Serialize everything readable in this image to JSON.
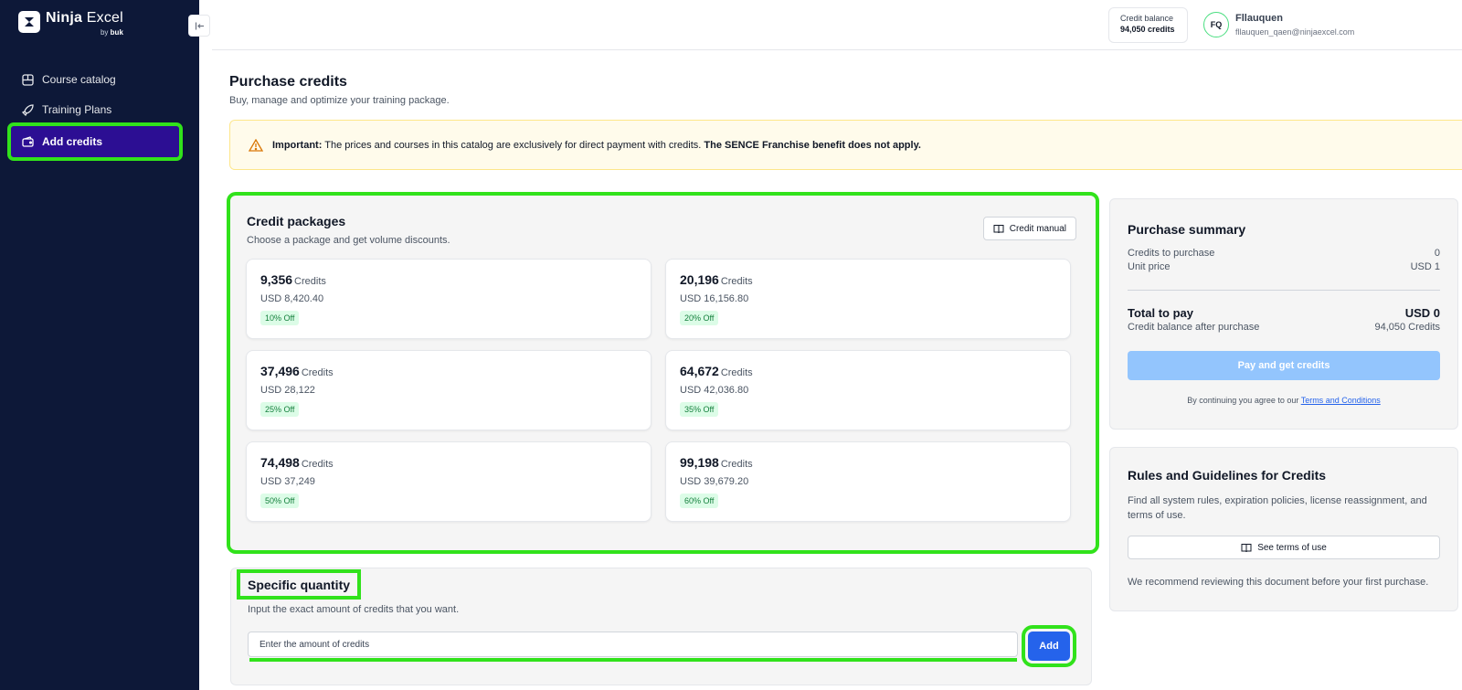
{
  "brand": {
    "name_bold": "Ninja",
    "name_light": "Excel",
    "by": "by",
    "by_brand": "buk"
  },
  "sidebar": {
    "items": [
      {
        "label": "Course catalog",
        "icon": "catalog-icon"
      },
      {
        "label": "Training Plans",
        "icon": "rocket-icon"
      },
      {
        "label": "Add credits",
        "icon": "wallet-icon",
        "active": true
      }
    ]
  },
  "header": {
    "balance_label": "Credit balance",
    "balance_value": "94,050 credits",
    "user_initials": "FQ",
    "user_name": "Fllauquen",
    "user_email": "fllauquen_qaen@ninjaexcel.com"
  },
  "page": {
    "title": "Purchase credits",
    "subtitle": "Buy, manage and optimize your training package."
  },
  "alert": {
    "label": "Important:",
    "text": " The prices and courses in this catalog are exclusively for direct payment with credits. ",
    "strong": "The SENCE Franchise benefit does not apply."
  },
  "packages": {
    "title": "Credit packages",
    "subtitle": "Choose a package and get volume discounts.",
    "manual_label": "Credit manual",
    "unit": "Credits",
    "items": [
      {
        "amount": "9,356",
        "price": "USD 8,420.40",
        "discount": "10% Off"
      },
      {
        "amount": "20,196",
        "price": "USD 16,156.80",
        "discount": "20% Off"
      },
      {
        "amount": "37,496",
        "price": "USD 28,122",
        "discount": "25% Off"
      },
      {
        "amount": "64,672",
        "price": "USD 42,036.80",
        "discount": "35% Off"
      },
      {
        "amount": "74,498",
        "price": "USD 37,249",
        "discount": "50% Off"
      },
      {
        "amount": "99,198",
        "price": "USD 39,679.20",
        "discount": "60% Off"
      }
    ]
  },
  "specific": {
    "title": "Specific quantity",
    "subtitle": "Input the exact amount of credits that you want.",
    "placeholder": "Enter the amount of credits",
    "add_label": "Add"
  },
  "summary": {
    "title": "Purchase summary",
    "credits_label": "Credits to purchase",
    "credits_value": "0",
    "unit_price_label": "Unit price",
    "unit_price_value": "USD 1",
    "total_label": "Total to pay",
    "total_value": "USD 0",
    "after_label": "Credit balance after purchase",
    "after_value": "94,050 Credits",
    "pay_label": "Pay and get credits",
    "terms_prefix": "By continuing you agree to our ",
    "terms_link": "Terms and Conditions"
  },
  "rules": {
    "title": "Rules and Guidelines for Credits",
    "text": "Find all system rules, expiration policies, license reassignment, and terms of use.",
    "button_label": "See terms of use",
    "note": "We recommend reviewing this document before your first purchase."
  },
  "colors": {
    "sidebar_bg": "#0d1838",
    "active_item": "#2c0e93",
    "highlight": "#31e21b",
    "primary": "#2563eb",
    "primary_disabled": "#93c5fd",
    "badge_bg": "#dcfce7",
    "badge_text": "#15803d"
  }
}
